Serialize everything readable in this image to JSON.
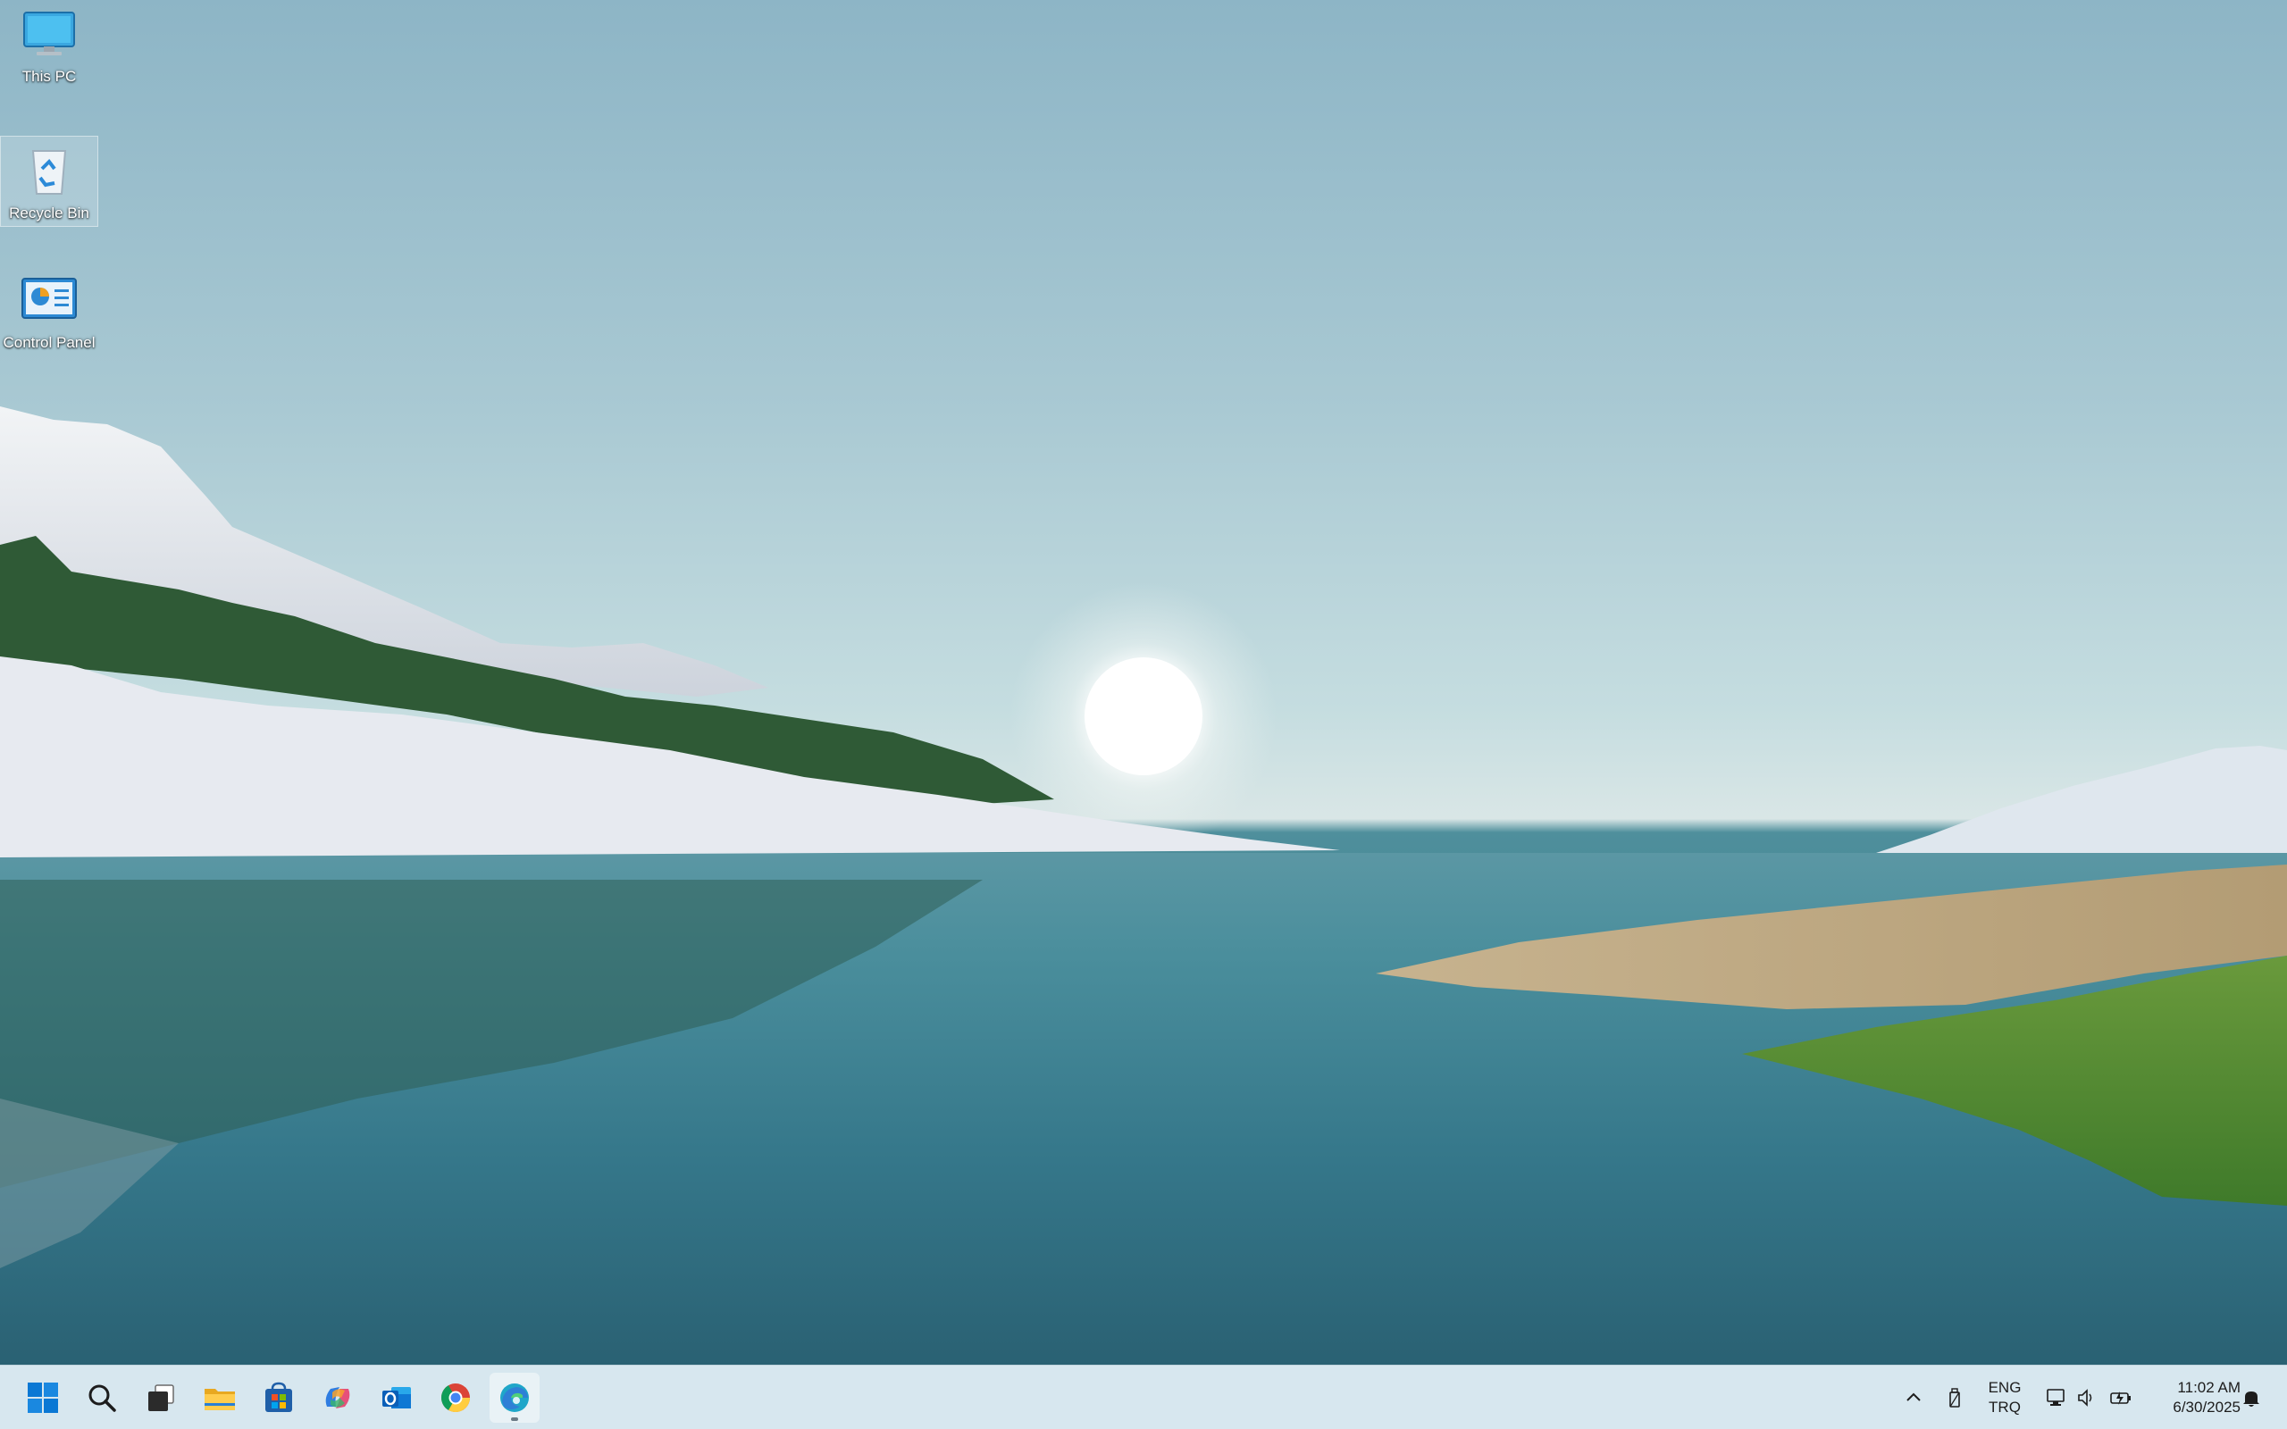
{
  "desktop": {
    "icons": [
      {
        "label": "This PC",
        "icon": "monitor-icon"
      },
      {
        "label": "Recycle Bin",
        "icon": "recycle-bin-icon",
        "selected": true
      },
      {
        "label": "Control Panel",
        "icon": "control-panel-icon"
      }
    ]
  },
  "taskbar": {
    "pinned": [
      {
        "name": "Start",
        "icon": "windows-logo-icon"
      },
      {
        "name": "Search",
        "icon": "search-icon"
      },
      {
        "name": "Task View",
        "icon": "task-view-icon"
      },
      {
        "name": "File Explorer",
        "icon": "folder-icon"
      },
      {
        "name": "Microsoft Store",
        "icon": "store-icon"
      },
      {
        "name": "Copilot",
        "icon": "copilot-icon"
      },
      {
        "name": "Outlook",
        "icon": "outlook-icon"
      },
      {
        "name": "Google Chrome",
        "icon": "chrome-icon"
      },
      {
        "name": "Microsoft Edge",
        "icon": "edge-icon",
        "running": true
      }
    ],
    "tray": {
      "icons": [
        "chevron-up-icon",
        "usb-drive-icon",
        "network-icon",
        "volume-icon",
        "battery-icon",
        "notification-bell-icon"
      ],
      "language": {
        "line1": "ENG",
        "line2": "TRQ"
      },
      "time": "11:02 AM",
      "date": "6/30/2025"
    }
  },
  "colors": {
    "taskbar_bg": "#d7e7ef",
    "windows_blue": "#0a78d4",
    "edge_teal": "#1fa6c9"
  }
}
